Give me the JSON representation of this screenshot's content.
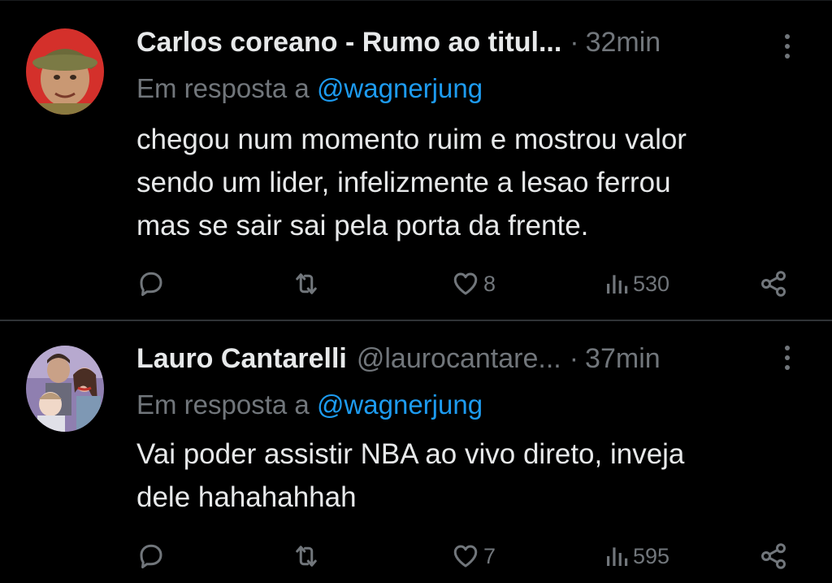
{
  "colors": {
    "background": "#000000",
    "text_primary": "#e7e9ea",
    "text_secondary": "#71767b",
    "mention": "#1d9bf0",
    "divider": "#2f3336"
  },
  "tweets": [
    {
      "author_name": "Carlos coreano - Rumo ao titul...",
      "handle": "",
      "separator": "·",
      "time": "32min",
      "reply_prefix": "Em resposta a",
      "reply_mention": "@wagnerjung",
      "text_lines": [
        "chegou num momento ruim e mostrou valor",
        "sendo um lider, infelizmente a lesao ferrou",
        "mas se sair sai pela porta da frente."
      ],
      "replies": "",
      "retweets": "",
      "likes": "8",
      "views": "530",
      "icons": [
        "reply-icon",
        "retweet-icon",
        "like-icon",
        "views-icon",
        "share-icon",
        "more-icon"
      ]
    },
    {
      "author_name": "Lauro Cantarelli",
      "handle": "@laurocantare...",
      "separator": "·",
      "time": "37min",
      "reply_prefix": "Em resposta a",
      "reply_mention": "@wagnerjung",
      "text_lines": [
        "Vai poder assistir NBA ao vivo direto,  inveja",
        "dele hahahahhah"
      ],
      "replies": "",
      "retweets": "",
      "likes": "7",
      "views": "595",
      "icons": [
        "reply-icon",
        "retweet-icon",
        "like-icon",
        "views-icon",
        "share-icon",
        "more-icon"
      ]
    }
  ]
}
